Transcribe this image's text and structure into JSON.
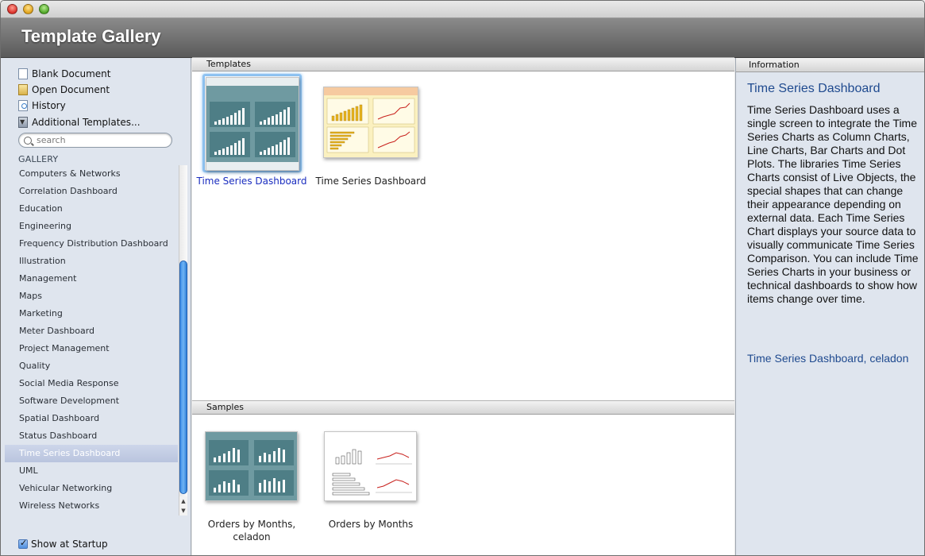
{
  "window": {
    "title": "Template Gallery"
  },
  "sidebar": {
    "links": [
      {
        "label": "Blank Document",
        "icon": "blank-document-icon"
      },
      {
        "label": "Open Document",
        "icon": "open-document-icon"
      },
      {
        "label": "History",
        "icon": "history-icon"
      },
      {
        "label": "Additional Templates...",
        "icon": "additional-templates-icon"
      }
    ],
    "search": {
      "placeholder": "search",
      "value": ""
    },
    "gallery_heading": "GALLERY",
    "gallery_items": [
      "Computers & Networks",
      "Correlation Dashboard",
      "Education",
      "Engineering",
      "Frequency Distribution Dashboard",
      "Illustration",
      "Management",
      "Maps",
      "Marketing",
      "Meter Dashboard",
      "Project Management",
      "Quality",
      "Social Media Response",
      "Software Development",
      "Spatial Dashboard",
      "Status Dashboard",
      "Time Series Dashboard",
      "UML",
      "Vehicular Networking",
      "Wireless Networks"
    ],
    "selected_item": "Time Series Dashboard",
    "show_at_startup": {
      "label": "Show at Startup",
      "checked": true
    }
  },
  "templates": {
    "heading": "Templates",
    "items": [
      {
        "caption": "Time Series Dashboard",
        "selected": true
      },
      {
        "caption": "Time Series Dashboard",
        "selected": false
      }
    ]
  },
  "samples": {
    "heading": "Samples",
    "items": [
      {
        "caption": "Orders by Months,\nceladon"
      },
      {
        "caption": "Orders by Months"
      }
    ]
  },
  "info": {
    "heading": "Information",
    "title": "Time Series Dashboard",
    "description": "Time Series Dashboard uses a single screen to integrate the Time Series Charts as Column Charts, Line Charts, Bar Charts and Dot Plots. The libraries Time Series Charts consist of Live Objects, the special shapes that can change their appearance depending on external data. Each Time Series Chart displays your source data to visually communicate Time Series Comparison. You can include Time Series Charts in your business or technical dashboards to show how items change over time.",
    "link": "Time Series Dashboard, celadon"
  },
  "colors": {
    "accent_selection": "#8fc3f2",
    "link_blue": "#1f4a8f",
    "celadon": "#6f9aa1",
    "yellow_theme": "#fbf1c0"
  }
}
